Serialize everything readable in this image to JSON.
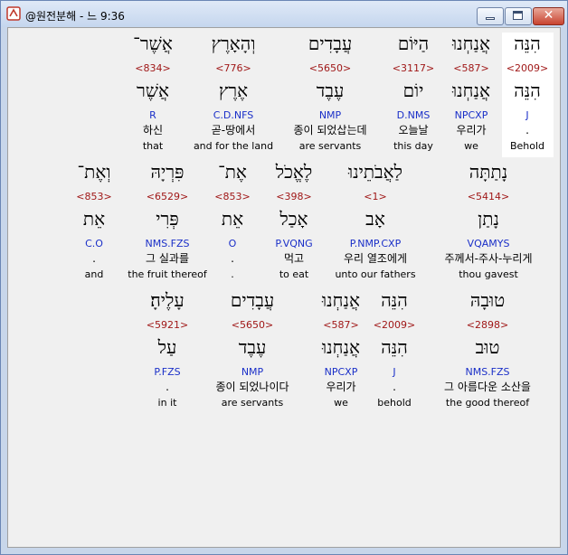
{
  "window": {
    "title": "@원전분해 - 느 9:36"
  },
  "rows": [
    [
      {
        "heb": "הִנֵּה",
        "strong": "<2009>",
        "lemma": "הִנֵּה",
        "morph": "J",
        "kor": ".",
        "eng": "Behold",
        "highlight": true
      },
      {
        "heb": "אֲנַחְנוּ",
        "strong": "<587>",
        "lemma": "אֲנַחְנוּ",
        "morph": "NPCXP",
        "kor": "우리가",
        "eng": "we"
      },
      {
        "heb": "הַיּוֹם",
        "strong": "<3117>",
        "lemma": "יוֹם",
        "morph": "D.NMS",
        "kor": "오늘날",
        "eng": "this day"
      },
      {
        "heb": "עֲבָדִים",
        "strong": "<5650>",
        "lemma": "עֶבֶד",
        "morph": "NMP",
        "kor": "종이 되었삽는데",
        "eng": "are servants"
      },
      {
        "heb": "וְהָאָרֶץ",
        "strong": "<776>",
        "lemma": "אֶרֶץ",
        "morph": "C.D.NFS",
        "kor": "곧-땅에서",
        "eng": "and for the land"
      },
      {
        "heb": "אֲשֶׁר־",
        "strong": "<834>",
        "lemma": "אֲשֶׁר",
        "morph": "R",
        "kor": "하신",
        "eng": "that"
      }
    ],
    [
      {
        "heb": "נָתַתָּה",
        "strong": "<5414>",
        "lemma": "נָתַן",
        "morph": "VQAMYS",
        "kor": "주께서-주사-누리게",
        "eng": "thou gavest"
      },
      {
        "heb": "לַאֲבֹתֵינוּ",
        "strong": "<1>",
        "lemma": "אָב",
        "morph": "P.NMP.CXP",
        "kor": "우리 열조에게",
        "eng": "unto our fathers"
      },
      {
        "heb": "לֶאֱכֹל",
        "strong": "<398>",
        "lemma": "אָכַל",
        "morph": "P.VQNG",
        "kor": "먹고",
        "eng": "to eat"
      },
      {
        "heb": "אֶת־",
        "strong": "<853>",
        "lemma": "אֵת",
        "morph": "O",
        "kor": ".",
        "eng": "."
      },
      {
        "heb": "פִּרְיָהּ",
        "strong": "<6529>",
        "lemma": "פְּרִי",
        "morph": "NMS.FZS",
        "kor": "그 실과를",
        "eng": "the fruit thereof"
      },
      {
        "heb": "וְאֶת־",
        "strong": "<853>",
        "lemma": "אֵת",
        "morph": "C.O",
        "kor": ".",
        "eng": "and"
      }
    ],
    [
      {
        "heb": "טוּבָהּ",
        "strong": "<2898>",
        "lemma": "טוּב",
        "morph": "NMS.FZS",
        "kor": "그 아름다운 소산을",
        "eng": "the good thereof"
      },
      {
        "heb": "הִנֵּה",
        "strong": "<2009>",
        "lemma": "הִנֵּה",
        "morph": "J",
        "kor": ".",
        "eng": "behold"
      },
      {
        "heb": "אֲנַחְנוּ",
        "strong": "<587>",
        "lemma": "אֲנַחְנוּ",
        "morph": "NPCXP",
        "kor": "우리가",
        "eng": "we"
      },
      {
        "heb": "עֲבָדִים",
        "strong": "<5650>",
        "lemma": "עֶבֶד",
        "morph": "NMP",
        "kor": "종이 되었나이다",
        "eng": "are servants"
      },
      {
        "heb": "עָלֶיהָ׃",
        "strong": "<5921>",
        "lemma": "עַל",
        "morph": "P.FZS",
        "kor": ".",
        "eng": "in it"
      }
    ]
  ]
}
